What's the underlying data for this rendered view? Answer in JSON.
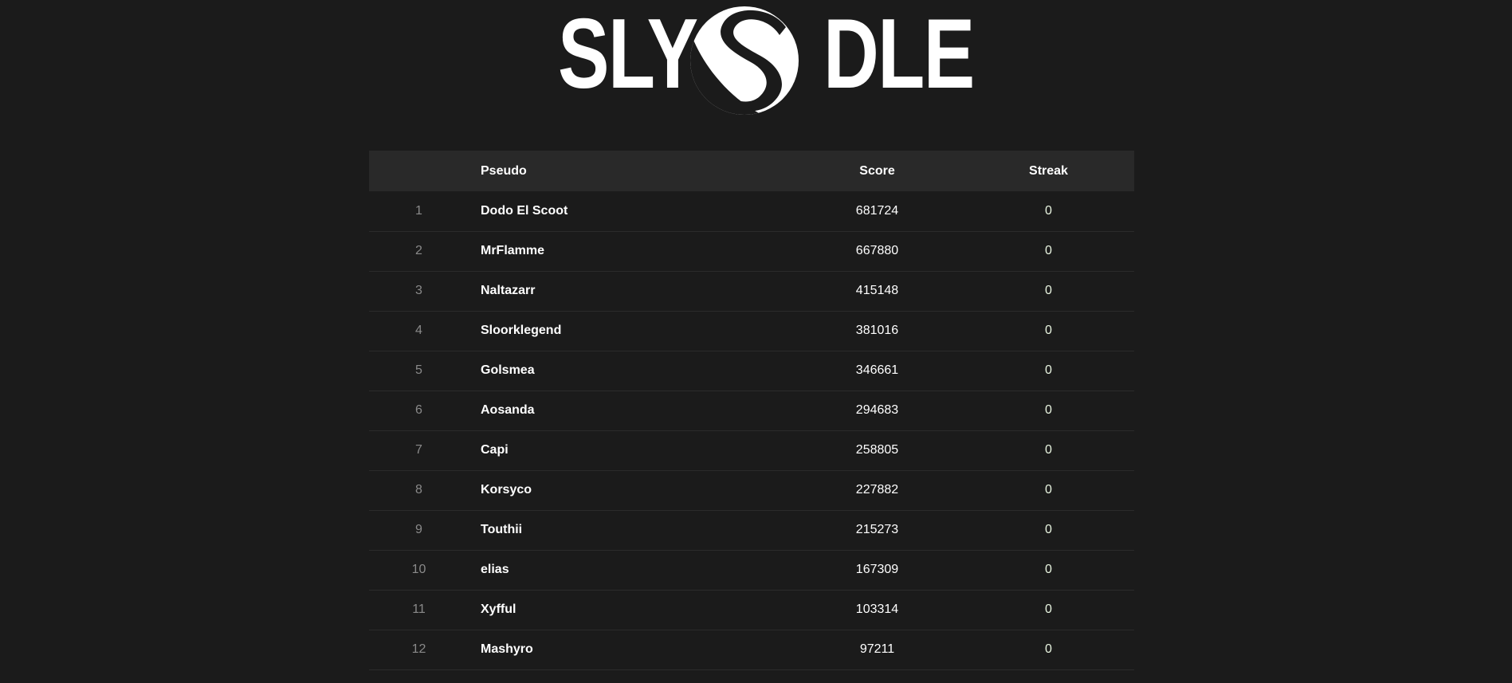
{
  "logo": {
    "text_left": "SLY",
    "text_right": "DLE",
    "emblem_icon": "s-circle-emblem-icon"
  },
  "leaderboard": {
    "headers": {
      "rank": "",
      "pseudo": "Pseudo",
      "score": "Score",
      "streak": "Streak"
    },
    "rows": [
      {
        "rank": "1",
        "pseudo": "Dodo El Scoot",
        "score": "681724",
        "streak": "0"
      },
      {
        "rank": "2",
        "pseudo": "MrFlamme",
        "score": "667880",
        "streak": "0"
      },
      {
        "rank": "3",
        "pseudo": "Naltazarr",
        "score": "415148",
        "streak": "0"
      },
      {
        "rank": "4",
        "pseudo": "Sloorklegend",
        "score": "381016",
        "streak": "0"
      },
      {
        "rank": "5",
        "pseudo": "Golsmea",
        "score": "346661",
        "streak": "0"
      },
      {
        "rank": "6",
        "pseudo": "Aosanda",
        "score": "294683",
        "streak": "0"
      },
      {
        "rank": "7",
        "pseudo": "Capi",
        "score": "258805",
        "streak": "0"
      },
      {
        "rank": "8",
        "pseudo": "Korsyco",
        "score": "227882",
        "streak": "0"
      },
      {
        "rank": "9",
        "pseudo": "Touthii",
        "score": "215273",
        "streak": "0"
      },
      {
        "rank": "10",
        "pseudo": "elias",
        "score": "167309",
        "streak": "0"
      },
      {
        "rank": "11",
        "pseudo": "Xyfful",
        "score": "103314",
        "streak": "0"
      },
      {
        "rank": "12",
        "pseudo": "Mashyro",
        "score": "97211",
        "streak": "0"
      }
    ]
  },
  "colors": {
    "background": "#1b1b1b",
    "header_bg": "#292929",
    "row_divider": "#2b2b2b",
    "rank_text": "#8a8a8a",
    "text": "#ffffff"
  }
}
